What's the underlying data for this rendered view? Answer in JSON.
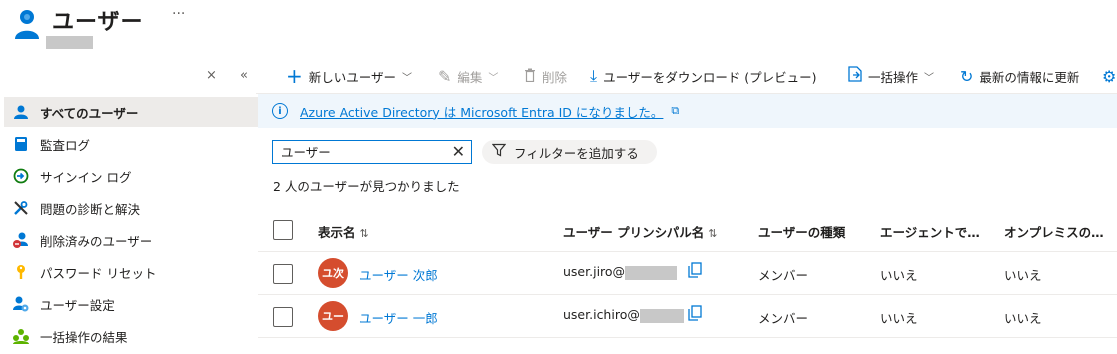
{
  "header": {
    "title": "ユーザー",
    "more": "···"
  },
  "sidebar": {
    "close": "×",
    "collapse": "«",
    "items": [
      {
        "label": "すべてのユーザー",
        "icon": "user-icon",
        "active": true
      },
      {
        "label": "監査ログ",
        "icon": "book-icon"
      },
      {
        "label": "サインイン ログ",
        "icon": "sign-in-icon"
      },
      {
        "label": "問題の診断と解決",
        "icon": "wrench-icon"
      },
      {
        "label": "削除済みのユーザー",
        "icon": "user-delete-icon"
      },
      {
        "label": "パスワード リセット",
        "icon": "key-icon"
      },
      {
        "label": "ユーザー設定",
        "icon": "user-settings-icon"
      },
      {
        "label": "一括操作の結果",
        "icon": "bulk-results-icon"
      }
    ]
  },
  "toolbar": {
    "new_user": "新しいユーザー",
    "edit": "編集",
    "delete": "削除",
    "download": "ユーザーをダウンロード (プレビュー)",
    "bulk": "一括操作",
    "refresh": "最新の情報に更新"
  },
  "banner": {
    "text": "Azure Active Directory は Microsoft Entra ID になりました。"
  },
  "search": {
    "value": "ユーザー"
  },
  "filter": {
    "label": "フィルターを追加する"
  },
  "result_count": "2 人のユーザーが見つかりました",
  "table": {
    "headers": {
      "display_name": "表示名",
      "upn": "ユーザー プリンシパル名",
      "user_type": "ユーザーの種類",
      "agent": "エージェントで…",
      "onprem": "オンプレミスの…"
    },
    "rows": [
      {
        "initials": "ユ次",
        "name": "ユーザー 次郎",
        "upn": "user.jiro@",
        "type": "メンバー",
        "agent": "いいえ",
        "onprem": "いいえ"
      },
      {
        "initials": "ユー",
        "name": "ユーザー 一郎",
        "upn": "user.ichiro@",
        "type": "メンバー",
        "agent": "いいえ",
        "onprem": "いいえ"
      }
    ]
  },
  "colors": {
    "accent": "#0078d4",
    "avatar": "#d54d2e",
    "banner": "#eff6fc",
    "active_nav": "#edebe9"
  }
}
